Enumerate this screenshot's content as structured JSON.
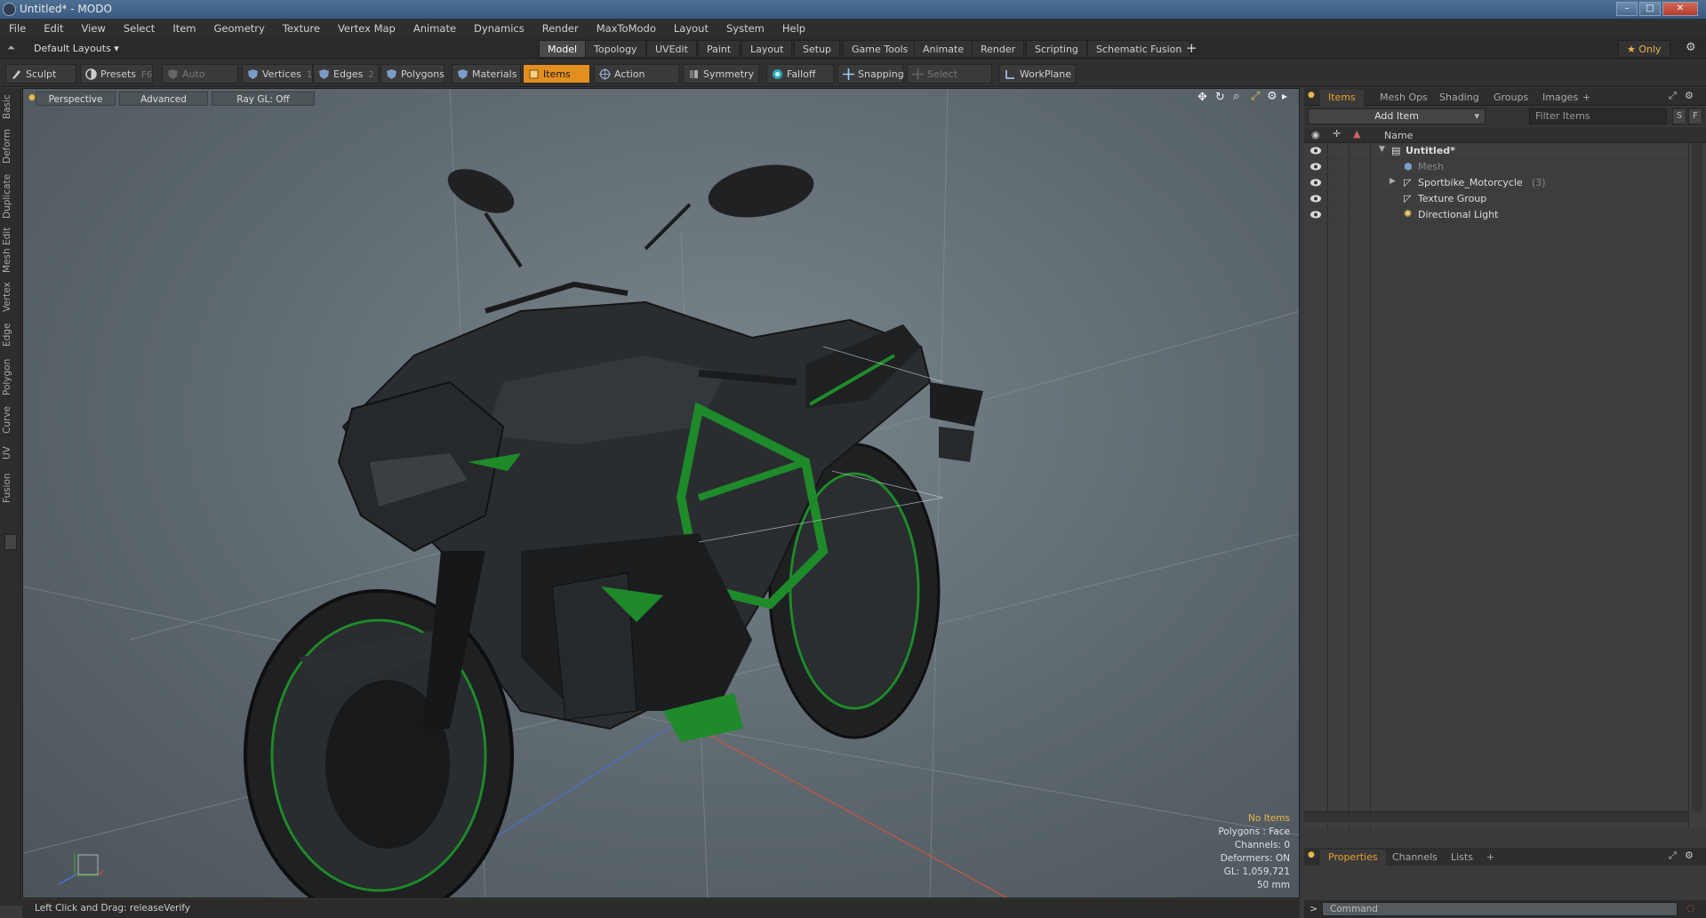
{
  "window": {
    "title": "Untitled* - MODO",
    "minimize": "–",
    "maximize": "□",
    "close": "✕"
  },
  "menu": [
    "File",
    "Edit",
    "View",
    "Select",
    "Item",
    "Geometry",
    "Texture",
    "Vertex Map",
    "Animate",
    "Dynamics",
    "Render",
    "MaxToModo",
    "Layout",
    "System",
    "Help"
  ],
  "layouts": {
    "dropdown": "Default Layouts ▾",
    "tabs": [
      "Model",
      "Topology",
      "UVEdit",
      "Paint",
      "Layout",
      "Setup",
      "Game Tools",
      "Animate",
      "Render",
      "Scripting",
      "Schematic Fusion"
    ],
    "active_tab": "Model",
    "add": "+",
    "only": "★ Only",
    "gear": "⚙"
  },
  "toolbar": {
    "sculpt": "Sculpt",
    "presets": "Presets",
    "presets_key": "F6",
    "auto_select": "Auto Select",
    "vertices": "Vertices",
    "vertices_key": "1",
    "edges": "Edges",
    "edges_key": "2",
    "polygons": "Polygons",
    "materials": "Materials",
    "items": "Items",
    "action_center": "Action Center",
    "symmetry": "Symmetry",
    "falloff": "Falloff",
    "snapping": "Snapping",
    "select_through": "Select Through",
    "workplane": "WorkPlane"
  },
  "left_tabs": [
    "Basic",
    "Deform",
    "Duplicate",
    "Mesh Edit",
    "Vertex",
    "Edge",
    "Polygon",
    "Curve",
    "UV",
    "Fusion"
  ],
  "viewport": {
    "perspective": "Perspective",
    "advanced": "Advanced",
    "raygl": "Ray GL: Off",
    "status": {
      "no_items": "No Items",
      "polygons": "Polygons : Face",
      "channels": "Channels: 0",
      "deformers": "Deformers: ON",
      "gl": "GL: 1,059,721",
      "lens": "50 mm"
    }
  },
  "right_panel": {
    "tabs": [
      "Items",
      "Mesh Ops",
      "Shading",
      "Groups",
      "Images",
      "+"
    ],
    "active_tab": "Items",
    "add_item": "Add Item",
    "filter_placeholder": "Filter Items",
    "s": "S",
    "f": "F",
    "name_col": "Name",
    "tree": [
      {
        "label": "Untitled*",
        "bold": true
      },
      {
        "label": "Mesh",
        "dim": true
      },
      {
        "label": "Sportbike_Motorcycle",
        "count": "(3)"
      },
      {
        "label": "Texture Group"
      },
      {
        "label": "Directional Light"
      }
    ],
    "bottom_tabs": [
      "Properties",
      "Channels",
      "Lists",
      "+"
    ],
    "bottom_active": "Properties"
  },
  "status_bar": {
    "text": "Left Click and Drag:  releaseVerify"
  },
  "command": {
    "placeholder": "Command",
    "prompt": ">"
  },
  "colors": {
    "accent": "#e28f1f",
    "viewport_bg": "#66717a",
    "panel_bg": "#3a3a3a"
  }
}
